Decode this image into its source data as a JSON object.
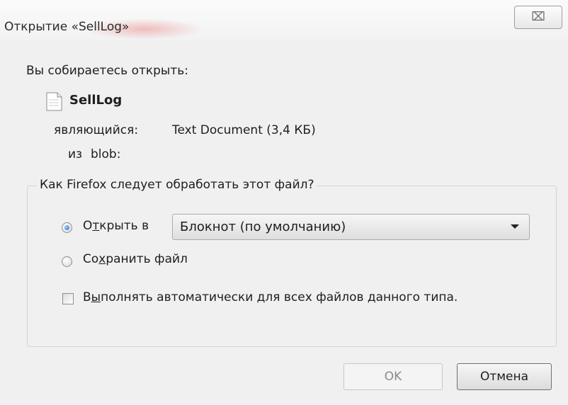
{
  "dialog": {
    "title": "Открытие «SellLog»",
    "close_icon": "close-icon",
    "close_glyph": "⌧"
  },
  "intro": "Вы собираетесь открыть:",
  "file": {
    "icon": "text-document-icon",
    "name": "SellLog",
    "type_label": "являющийся:",
    "type_value": "Text Document (3,4 КБ)",
    "source_label": "из",
    "source_value": "blob:"
  },
  "action_group": {
    "legend": "Как Firefox следует обработать этот файл?",
    "open_with": {
      "pre": "О",
      "key": "т",
      "post": "крыть в",
      "selected": true
    },
    "app_select": {
      "value": "Блокнот (по умолчанию)"
    },
    "save_file": {
      "pre": "Со",
      "key": "х",
      "post": "ранить файл",
      "selected": false
    },
    "auto": {
      "pre": "В",
      "key": "ы",
      "post": "полнять автоматически для всех файлов данного типа.",
      "checked": false
    }
  },
  "buttons": {
    "ok": "OK",
    "cancel": "Отмена"
  },
  "colors": {
    "background": "#f0f0f0",
    "radio_selected": "#1e66c8",
    "disabled_text": "#8a8a8a"
  }
}
